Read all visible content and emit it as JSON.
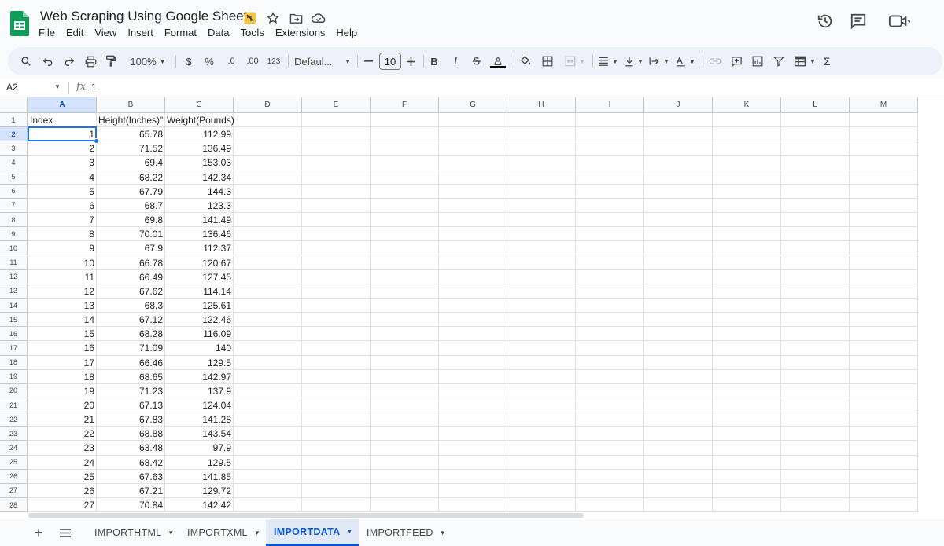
{
  "doc": {
    "title": "Web Scraping Using Google Sheets",
    "title_icons": [
      "shared-drive-icon",
      "star-icon",
      "move-folder-icon",
      "cloud-saved-icon"
    ],
    "right_icons": [
      "version-history-icon",
      "comments-icon",
      "meet-icon"
    ]
  },
  "menu": [
    "File",
    "Edit",
    "View",
    "Insert",
    "Format",
    "Data",
    "Tools",
    "Extensions",
    "Help"
  ],
  "toolbar": {
    "zoom": "100%",
    "currency": "$",
    "percent": "%",
    "decrease_decimal": ".0",
    "increase_decimal": ".00",
    "number_format": "123",
    "font": "Defaul...",
    "font_size": "10",
    "bold": "B",
    "italic": "I",
    "text_color_label": "A",
    "sum": "Σ"
  },
  "formula_bar": {
    "name_box": "A2",
    "fx": "fx",
    "value": "1"
  },
  "colors": {
    "accent": "#0b57d0",
    "selection": "#1a73e8",
    "header_bg": "#f8f9fa",
    "header_selected_bg": "#d3e3fd"
  },
  "grid": {
    "columns": [
      "A",
      "B",
      "C",
      "D",
      "E",
      "F",
      "G",
      "H",
      "I",
      "J",
      "K",
      "L",
      "M"
    ],
    "selected_column": "A",
    "selected_row": 2,
    "rows": [
      {
        "n": "1",
        "a": "Index",
        "b": "Height(Inches)\"",
        "c": "Weight(Pounds)"
      },
      {
        "n": "2",
        "a": "1",
        "b": "65.78",
        "c": "112.99"
      },
      {
        "n": "3",
        "a": "2",
        "b": "71.52",
        "c": "136.49"
      },
      {
        "n": "4",
        "a": "3",
        "b": "69.4",
        "c": "153.03"
      },
      {
        "n": "5",
        "a": "4",
        "b": "68.22",
        "c": "142.34"
      },
      {
        "n": "6",
        "a": "5",
        "b": "67.79",
        "c": "144.3"
      },
      {
        "n": "7",
        "a": "6",
        "b": "68.7",
        "c": "123.3"
      },
      {
        "n": "8",
        "a": "7",
        "b": "69.8",
        "c": "141.49"
      },
      {
        "n": "9",
        "a": "8",
        "b": "70.01",
        "c": "136.46"
      },
      {
        "n": "10",
        "a": "9",
        "b": "67.9",
        "c": "112.37"
      },
      {
        "n": "11",
        "a": "10",
        "b": "66.78",
        "c": "120.67"
      },
      {
        "n": "12",
        "a": "11",
        "b": "66.49",
        "c": "127.45"
      },
      {
        "n": "13",
        "a": "12",
        "b": "67.62",
        "c": "114.14"
      },
      {
        "n": "14",
        "a": "13",
        "b": "68.3",
        "c": "125.61"
      },
      {
        "n": "15",
        "a": "14",
        "b": "67.12",
        "c": "122.46"
      },
      {
        "n": "16",
        "a": "15",
        "b": "68.28",
        "c": "116.09"
      },
      {
        "n": "17",
        "a": "16",
        "b": "71.09",
        "c": "140"
      },
      {
        "n": "18",
        "a": "17",
        "b": "66.46",
        "c": "129.5"
      },
      {
        "n": "19",
        "a": "18",
        "b": "68.65",
        "c": "142.97"
      },
      {
        "n": "20",
        "a": "19",
        "b": "71.23",
        "c": "137.9"
      },
      {
        "n": "21",
        "a": "20",
        "b": "67.13",
        "c": "124.04"
      },
      {
        "n": "22",
        "a": "21",
        "b": "67.83",
        "c": "141.28"
      },
      {
        "n": "23",
        "a": "22",
        "b": "68.88",
        "c": "143.54"
      },
      {
        "n": "24",
        "a": "23",
        "b": "63.48",
        "c": "97.9"
      },
      {
        "n": "25",
        "a": "24",
        "b": "68.42",
        "c": "129.5"
      },
      {
        "n": "26",
        "a": "25",
        "b": "67.63",
        "c": "141.85"
      },
      {
        "n": "27",
        "a": "26",
        "b": "67.21",
        "c": "129.72"
      },
      {
        "n": "28",
        "a": "27",
        "b": "70.84",
        "c": "142.42"
      }
    ]
  },
  "sheets": {
    "add_label": "+",
    "tabs": [
      "IMPORTHTML",
      "IMPORTXML",
      "IMPORTDATA",
      "IMPORTFEED"
    ],
    "active": "IMPORTDATA"
  }
}
